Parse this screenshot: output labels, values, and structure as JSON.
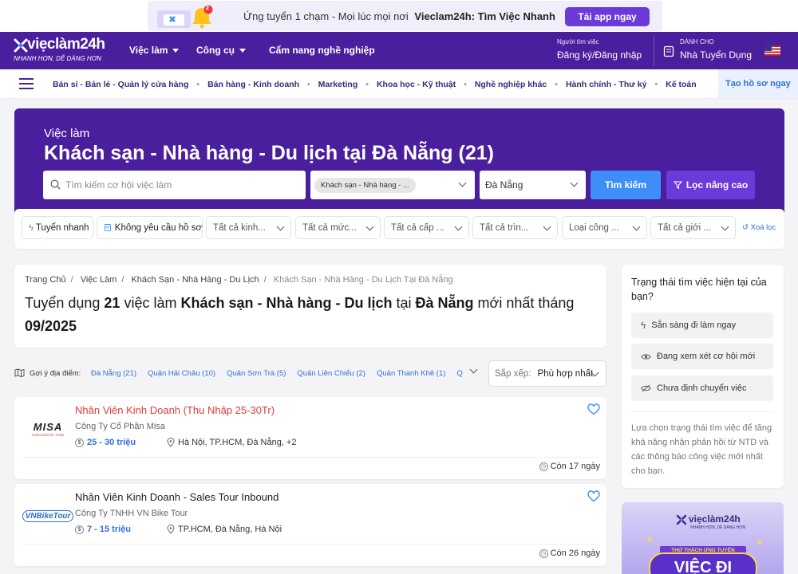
{
  "promo": {
    "badge_count": "2",
    "text_prefix": "Ứng tuyển 1 chạm - Mọi lúc mọi nơi",
    "text_brand": "Vieclam24h: Tìm Việc Nhanh",
    "button": "Tải app ngay"
  },
  "nav": {
    "logo": "viẹclàm24h",
    "logo_tagline": "NHANH HƠN, DỄ DÀNG HƠN",
    "items": [
      "Việc làm",
      "Công cụ",
      "Cẩm nang nghề nghiệp"
    ],
    "jobseeker_small": "Người tìm việc",
    "jobseeker_link": "Đăng ký/Đăng nhập",
    "employer_small": "DÀNH CHO",
    "employer_link": "Nhà Tuyển Dụng"
  },
  "categories": [
    "Bán sỉ - Bán lẻ - Quản lý cửa hàng",
    "Bán hàng - Kinh doanh",
    "Marketing",
    "Khoa học - Kỹ thuật",
    "Nghề nghiệp khác",
    "Hành chính - Thư ký",
    "Kế toán"
  ],
  "create_profile": "Tạo hồ sơ ngay",
  "hero": {
    "subtitle": "Việc làm",
    "title": "Khách sạn - Nhà hàng - Du lịch tại Đà Nẵng (21)",
    "search_placeholder": "Tìm kiếm cơ hội việc làm",
    "category_chip": "Khách sạn - Nhà hàng - ...",
    "location": "Đà Nẵng",
    "search_button": "Tìm kiếm",
    "advanced_button": "Lọc nâng cao"
  },
  "filters": {
    "quick": "Tuyển nhanh",
    "no_cv": "Không yêu cầu hồ sơ",
    "dropdowns": [
      "Tất cả kinh...",
      "Tất cả mức...",
      "Tất cả cấp ...",
      "Tất cả trìn...",
      "Loại công ...",
      "Tất cả giới ..."
    ],
    "reset": "Xoá lọc"
  },
  "breadcrumb": [
    "Trang Chủ",
    "Việc Làm",
    "Khách Sạn - Nhà Hàng - Du Lịch",
    "Khách Sạn - Nhà Hàng - Du Lịch Tại Đà Nẵng"
  ],
  "heading": {
    "p1": "Tuyển dụng ",
    "count": "21",
    "p2": " việc làm ",
    "category": "Khách sạn - Nhà hàng - Du lịch",
    "p3": " tại ",
    "city": "Đà Nẵng",
    "p4": " mới nhất tháng ",
    "month": "09/2025"
  },
  "locations": {
    "label": "Gợi ý địa điểm:",
    "items": [
      "Đà Nẵng (21)",
      "Quận Hải Châu (10)",
      "Quận Sơn Trà (5)",
      "Quận Liên Chiểu (2)",
      "Quận Thanh Khê (1)",
      "Q"
    ]
  },
  "sort": {
    "label": "Sắp xếp:",
    "value": "Phù hợp nhất"
  },
  "jobs": [
    {
      "title": "Nhân Viên Kinh Doanh (Thu Nhập 25-30Tr)",
      "company": "Công Ty Cổ Phần Misa",
      "logo_text": "MISA",
      "logo_sub": "PHẦN MỀM KẾ TOÁN",
      "salary": "25 - 30 triệu",
      "location": "Hà Nội, TP.HCM, Đà Nẵng, +2",
      "days": "Còn 17 ngày",
      "title_color": "#e03a3a"
    },
    {
      "title": "Nhân Viên Kinh Doanh - Sales Tour Inbound",
      "company": "Công Ty TNHH VN Bike Tour",
      "logo_text": "VNBikeTour",
      "logo_sub": "",
      "salary": "7 - 15 triệu",
      "location": "TP.HCM, Đà Nẵng, Hà Nội",
      "days": "Còn 26 ngày",
      "title_color": "#222222"
    }
  ],
  "sidebar": {
    "title": "Trạng thái tìm việc hiện tại của bạn?",
    "options": [
      "Sẵn sàng đi làm ngay",
      "Đang xem xét cơ hội mới",
      "Chưa định chuyển việc"
    ],
    "description": "Lựa chọn trạng thái tìm việc để tăng khả năng nhận phản hồi từ NTD và các thông báo công việc mới nhất cho bạn."
  },
  "ad": {
    "logo": "viẹclàm24h",
    "tagline": "NHANH HƠN, DỄ DÀNG HƠN",
    "ribbon": "THỬ THÁCH ỨNG TUYỂN",
    "big": "VIỆC ĐI"
  },
  "colors": {
    "brand_purple": "#4a1f9e",
    "accent_purple": "#6c3ad8",
    "blue": "#3e8ef7",
    "link_blue": "#3370d6",
    "hot_red": "#e03a3a"
  }
}
